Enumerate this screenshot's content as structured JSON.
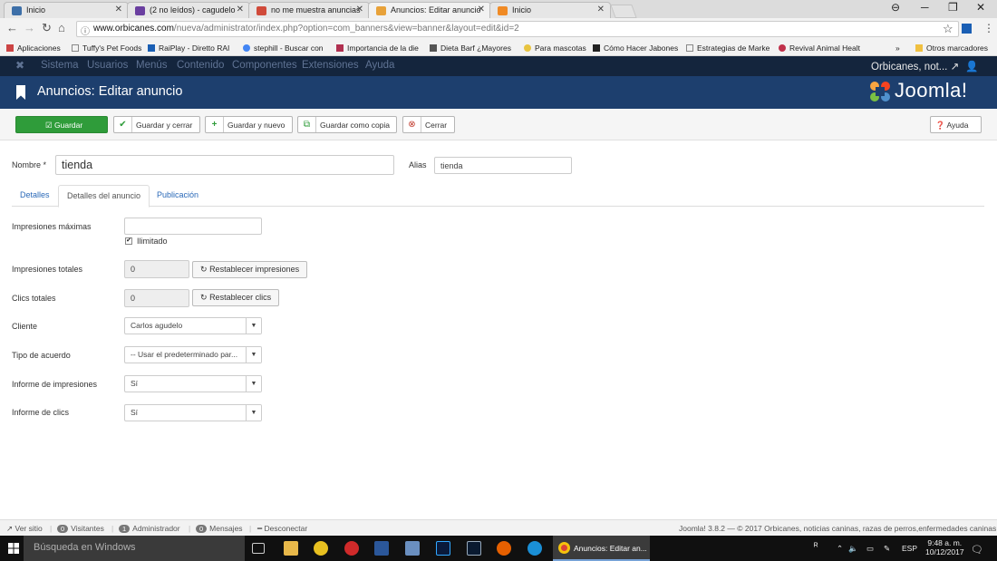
{
  "browser": {
    "tabs": [
      {
        "title": "Inicio",
        "color": "#3d6fa8"
      },
      {
        "title": "(2 no leídos) - cagudelo",
        "color": "#6a3fa0"
      },
      {
        "title": "no me muestra anuncias",
        "color": "#d04a3a"
      },
      {
        "title": "Anuncios: Editar anuncio",
        "color": "#e8a23a"
      },
      {
        "title": "Inicio",
        "color": "#f08a24"
      }
    ],
    "url_domain": "www.orbicanes.com",
    "url_path": "/nueva/administrator/index.php?option=com_banners&view=banner&layout=edit&id=2",
    "bookmarks": [
      "Aplicaciones",
      "Tuffy's Pet Foods",
      "RaiPlay - Diretto RAI",
      "stephill - Buscar con",
      "Importancia de la die",
      "Dieta Barf ¿Mayores",
      "Para mascotas",
      "Cómo Hacer Jabones",
      "Estrategias de Marke",
      "Revival Animal Healt"
    ],
    "more_bookmarks": "»",
    "other_bookmarks": "Otros marcadores"
  },
  "joomla": {
    "menu": [
      "Sistema",
      "Usuarios",
      "Menús",
      "Contenido",
      "Componentes",
      "Extensiones",
      "Ayuda"
    ],
    "site_name": "Orbicanes, not...",
    "page_title": "Anuncios: Editar anuncio",
    "logo_text": "Joomla!",
    "toolbar": {
      "save": "Guardar",
      "save_close": "Guardar y cerrar",
      "save_new": "Guardar y nuevo",
      "save_copy": "Guardar como copia",
      "close": "Cerrar",
      "help": "Ayuda"
    },
    "form": {
      "name_label": "Nombre *",
      "name_value": "tienda",
      "alias_label": "Alias",
      "alias_value": "tienda"
    },
    "tabs": [
      "Detalles",
      "Detalles del anuncio",
      "Publicación"
    ],
    "fields": {
      "max_impressions_label": "Impresiones máximas",
      "max_impressions_value": "",
      "unlimited_label": "Ilimitado",
      "total_impressions_label": "Impresiones totales",
      "total_impressions_value": "0",
      "reset_impressions": "Restablecer impresiones",
      "total_clicks_label": "Clics totales",
      "total_clicks_value": "0",
      "reset_clicks": "Restablecer clics",
      "client_label": "Cliente",
      "client_value": "Carlos agudelo",
      "purchase_type_label": "Tipo de acuerdo",
      "purchase_type_value": "-- Usar el predeterminado par...",
      "track_impressions_label": "Informe de impresiones",
      "track_impressions_value": "Sí",
      "track_clicks_label": "Informe de clics",
      "track_clicks_value": "Sí"
    },
    "status": {
      "view_site": "Ver sitio",
      "visitors_count": "0",
      "visitors": "Visitantes",
      "admin_count": "1",
      "admin": "Administrador",
      "messages_count": "0",
      "messages": "Mensajes",
      "logout": "Desconectar",
      "footer": "Joomla! 3.8.2 — © 2017 Orbicanes, noticias caninas, razas de perros,enfermedades caninas"
    }
  },
  "taskbar": {
    "search_placeholder": "Búsqueda en Windows",
    "active_app": "Anuncios: Editar an...",
    "language": "ESP",
    "time": "9:48 a. m.",
    "date": "10/12/2017"
  }
}
